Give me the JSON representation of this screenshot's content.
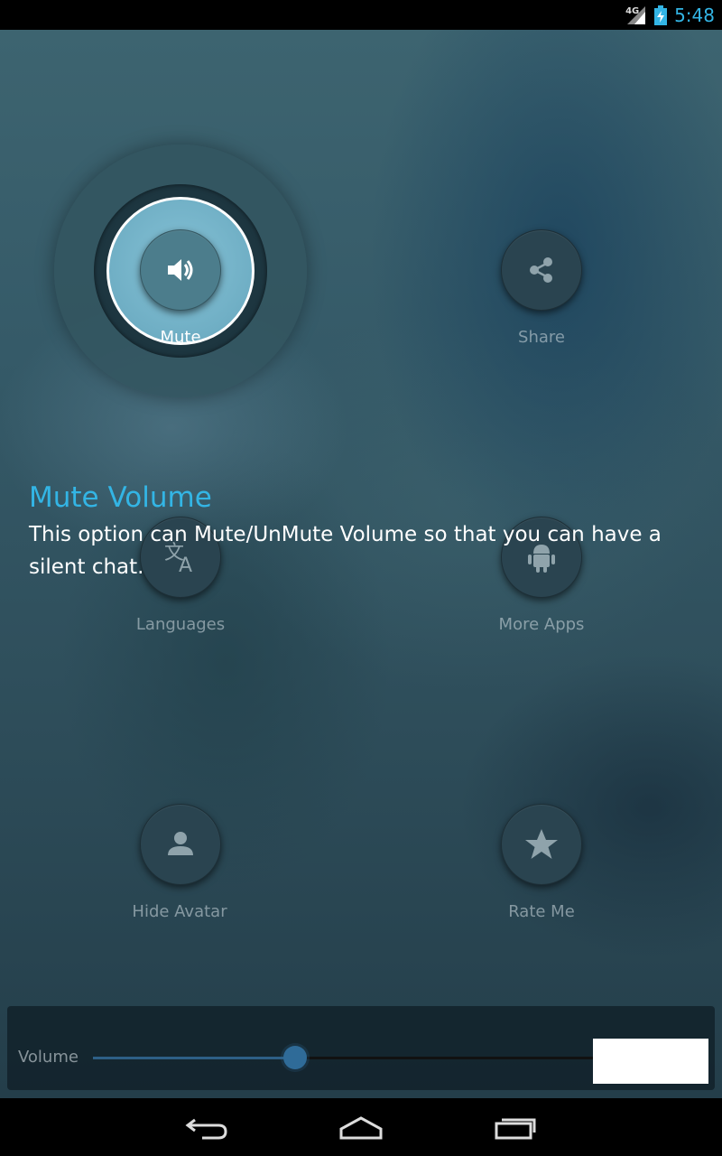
{
  "status_bar": {
    "network": "4G",
    "time": "5:48",
    "icons": [
      "signal-icon",
      "battery-charging-icon"
    ]
  },
  "menu": {
    "mute": {
      "label": "Mute",
      "icon": "speaker-icon"
    },
    "share": {
      "label": "Share",
      "icon": "share-icon"
    },
    "languages": {
      "label": "Languages",
      "icon": "translate-icon"
    },
    "more_apps": {
      "label": "More Apps",
      "icon": "android-icon"
    },
    "hide_avatar": {
      "label": "Hide Avatar",
      "icon": "person-icon"
    },
    "rate_me": {
      "label": "Rate Me",
      "icon": "star-icon"
    }
  },
  "hint": {
    "title": "Mute Volume",
    "body": "This option can Mute/UnMute Volume so that you can have a silent chat."
  },
  "volume": {
    "label": "Volume",
    "level": 0.4
  },
  "nav": {
    "icons": [
      "back-icon",
      "home-icon",
      "recents-icon"
    ]
  },
  "colors": {
    "accent": "#33b5e5",
    "highlight_ring": "#ffffff",
    "slider": "#2f6b98"
  }
}
